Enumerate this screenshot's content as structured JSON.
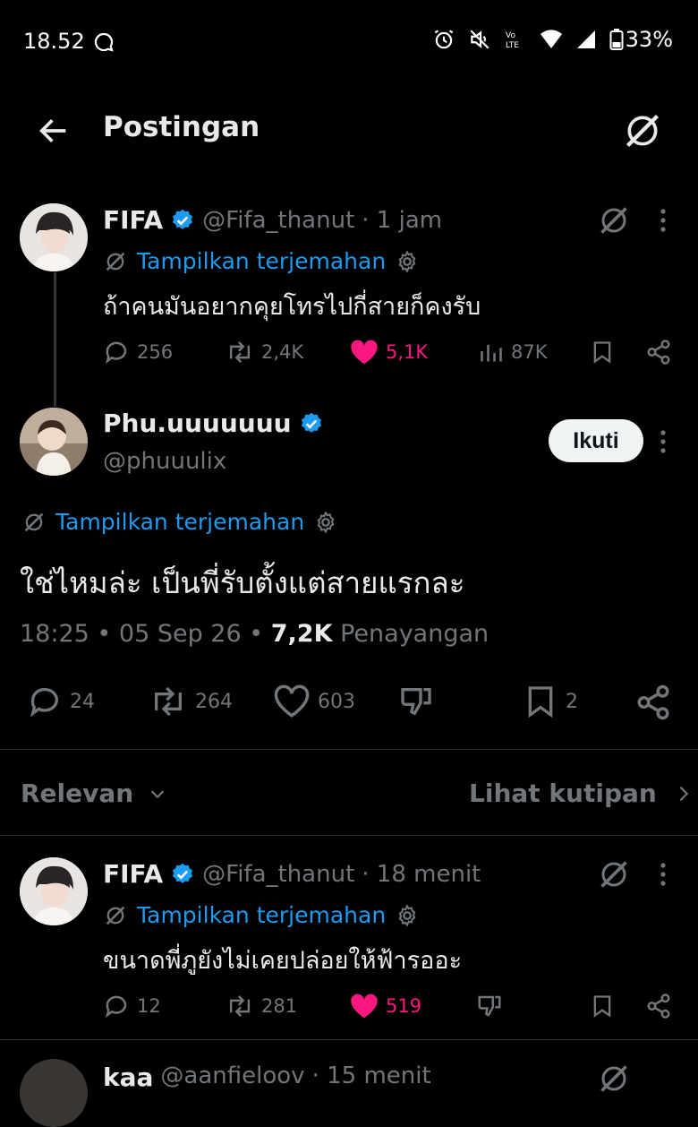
{
  "status_bar": {
    "time": "18.52",
    "battery": "33%"
  },
  "header": {
    "title": "Postingan"
  },
  "parent_tweet": {
    "name": "FIFA",
    "handle": "@Fifa_thanut",
    "time": "· 1 jam",
    "translate_label": "Tampilkan terjemahan",
    "text": "ถ้าคนมันอยากคุยโทรไปกี่สายก็คงรับ",
    "replies": "256",
    "reposts": "2,4K",
    "likes": "5,1K",
    "views": "87K"
  },
  "main_tweet": {
    "name": "Phu.uuuuuuu",
    "handle": "@phuuulix",
    "follow_label": "Ikuti",
    "translate_label": "Tampilkan terjemahan",
    "text": "ใช่ไหมล่ะ เป็นพี่รับตั้งแต่สายแรกละ",
    "timestamp": "18:25 • 05 Sep 26 • ",
    "views_count": "7,2K",
    "views_label": " Penayangan",
    "replies": "24",
    "reposts": "264",
    "likes": "603",
    "bookmarks": "2"
  },
  "sort_bar": {
    "relevance_label": "Relevan",
    "quotes_label": "Lihat kutipan"
  },
  "reply_tweet": {
    "name": "FIFA",
    "handle": "@Fifa_thanut",
    "time": "· 18 menit",
    "translate_label": "Tampilkan terjemahan",
    "text": "ขนาดพี่ภูยังไม่เคยปล่อยให้ฟ้ารออะ",
    "replies": "12",
    "reposts": "281",
    "likes": "519"
  },
  "partial_tweet": {
    "name": "kaa",
    "handle": "@aanfieloov",
    "time": "· 15 menit"
  },
  "colors": {
    "background": "#000000",
    "link_blue": "#1d9bf0",
    "like_pink": "#f91880",
    "muted_gray": "#71767b",
    "text": "#e7e9ea"
  }
}
